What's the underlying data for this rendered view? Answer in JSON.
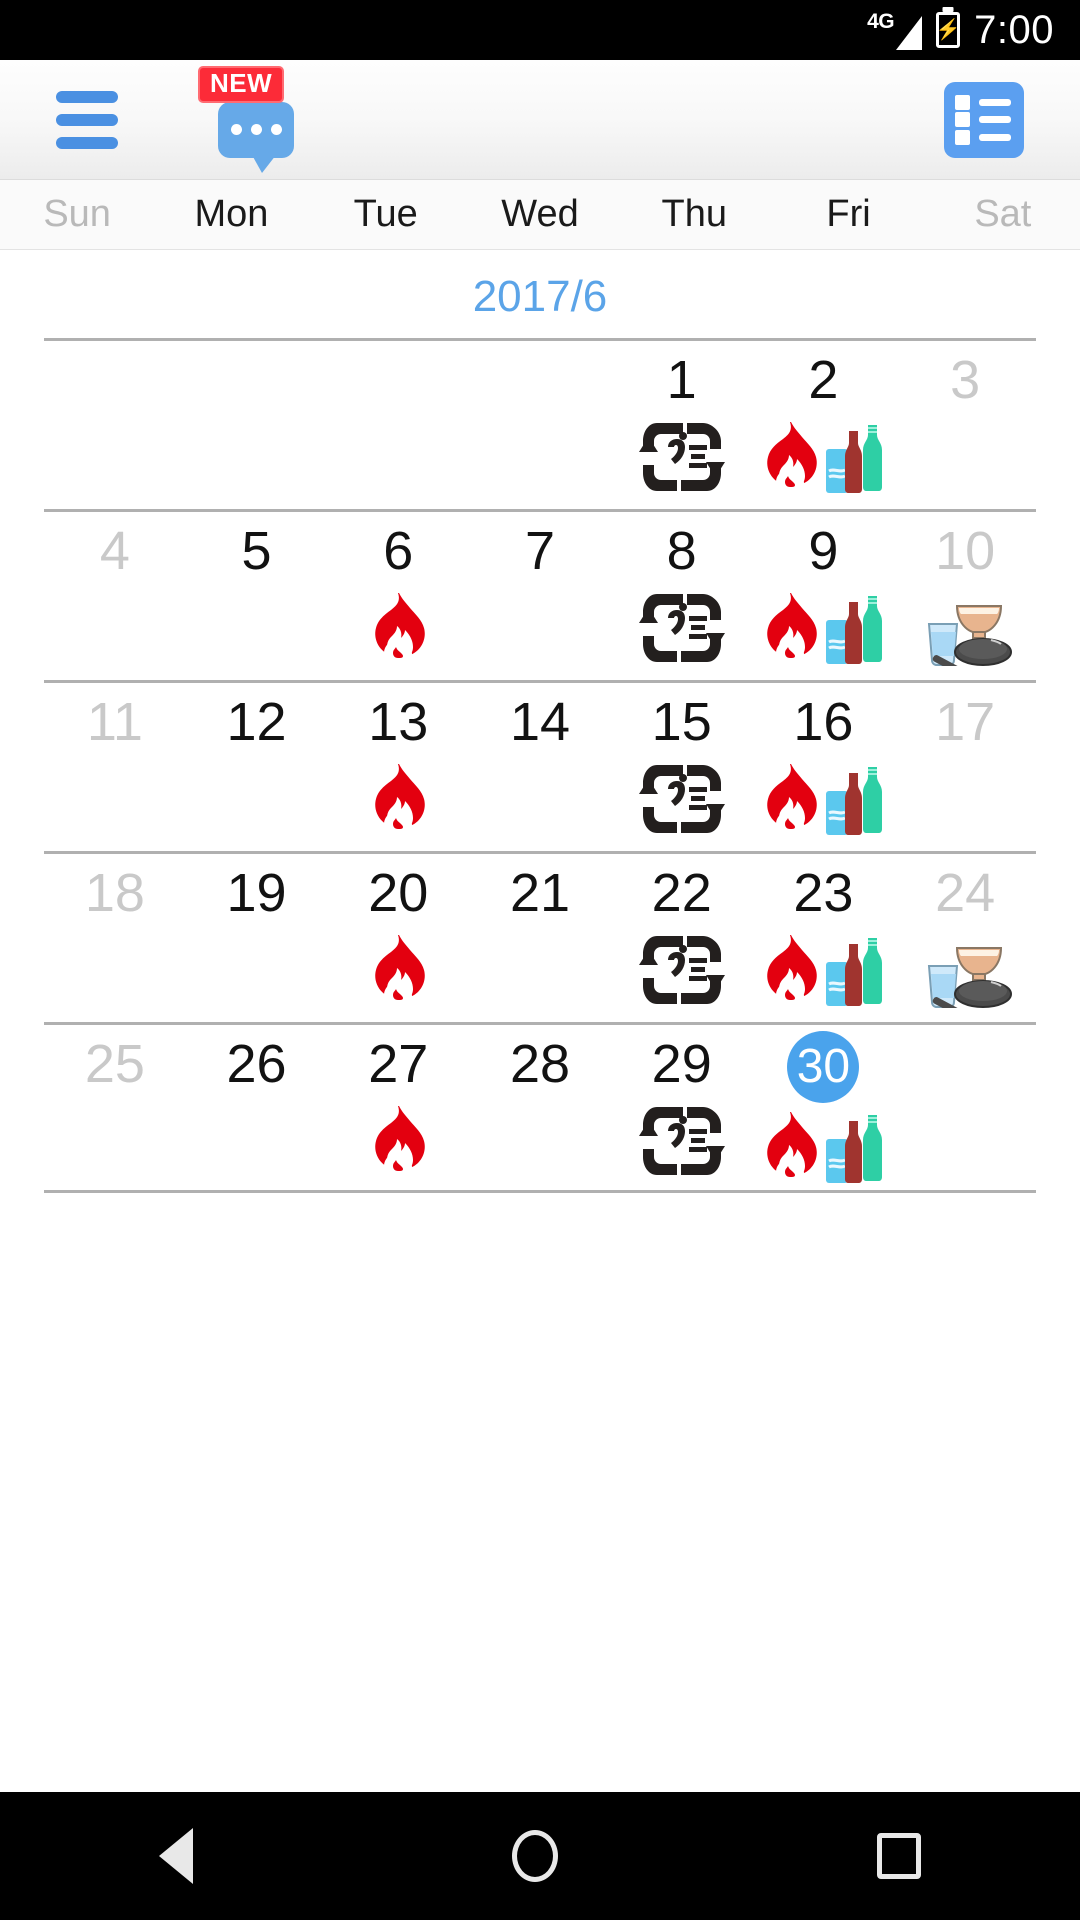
{
  "status_bar": {
    "network": "4G",
    "battery_icon": "battery-charging-icon",
    "time": "7:00"
  },
  "toolbar": {
    "menu_icon": "hamburger-menu-icon",
    "chat_icon": "chat-bubble-icon",
    "new_badge": "NEW",
    "list_icon": "agenda-list-icon"
  },
  "weekdays": [
    {
      "label": "Sun",
      "weekend": true
    },
    {
      "label": "Mon",
      "weekend": false
    },
    {
      "label": "Tue",
      "weekend": false
    },
    {
      "label": "Wed",
      "weekend": false
    },
    {
      "label": "Thu",
      "weekend": false
    },
    {
      "label": "Fri",
      "weekend": false
    },
    {
      "label": "Sat",
      "weekend": true
    }
  ],
  "month_title": "2017/6",
  "nav": {
    "prev_month_icon": "chevron-left-icon",
    "prev_month_label": "‹",
    "next_month_icon": "chevron-right-icon",
    "next_month_label": "›"
  },
  "colors": {
    "accent_blue": "#4a9de8",
    "today_blue": "#4aa3ec",
    "flame_red": "#e3000f",
    "badge_red": "#fc2b38",
    "weekend_gray": "#c9c9c9",
    "plastic_dark": "#231f1e"
  },
  "legend": {
    "flame": "burnable-garbage-icon",
    "plastic": "plastic-recycle-icon",
    "bottles": "bottles-and-cans-icon",
    "nonburnable": "non-burnable-garbage-icon"
  },
  "weeks": [
    [
      {
        "day": "",
        "weekend": true,
        "today": false,
        "icons": []
      },
      {
        "day": "",
        "weekend": false,
        "today": false,
        "icons": []
      },
      {
        "day": "",
        "weekend": false,
        "today": false,
        "icons": []
      },
      {
        "day": "",
        "weekend": false,
        "today": false,
        "icons": []
      },
      {
        "day": "1",
        "weekend": false,
        "today": false,
        "icons": [
          "plastic"
        ]
      },
      {
        "day": "2",
        "weekend": false,
        "today": false,
        "icons": [
          "flame",
          "bottles"
        ]
      },
      {
        "day": "3",
        "weekend": true,
        "today": false,
        "icons": []
      }
    ],
    [
      {
        "day": "4",
        "weekend": true,
        "today": false,
        "icons": []
      },
      {
        "day": "5",
        "weekend": false,
        "today": false,
        "icons": []
      },
      {
        "day": "6",
        "weekend": false,
        "today": false,
        "icons": [
          "flame"
        ]
      },
      {
        "day": "7",
        "weekend": false,
        "today": false,
        "icons": []
      },
      {
        "day": "8",
        "weekend": false,
        "today": false,
        "icons": [
          "plastic"
        ]
      },
      {
        "day": "9",
        "weekend": false,
        "today": false,
        "icons": [
          "flame",
          "bottles"
        ]
      },
      {
        "day": "10",
        "weekend": true,
        "today": false,
        "icons": [
          "nonburnable"
        ]
      }
    ],
    [
      {
        "day": "11",
        "weekend": true,
        "today": false,
        "icons": []
      },
      {
        "day": "12",
        "weekend": false,
        "today": false,
        "icons": []
      },
      {
        "day": "13",
        "weekend": false,
        "today": false,
        "icons": [
          "flame"
        ]
      },
      {
        "day": "14",
        "weekend": false,
        "today": false,
        "icons": []
      },
      {
        "day": "15",
        "weekend": false,
        "today": false,
        "icons": [
          "plastic"
        ]
      },
      {
        "day": "16",
        "weekend": false,
        "today": false,
        "icons": [
          "flame",
          "bottles"
        ]
      },
      {
        "day": "17",
        "weekend": true,
        "today": false,
        "icons": []
      }
    ],
    [
      {
        "day": "18",
        "weekend": true,
        "today": false,
        "icons": []
      },
      {
        "day": "19",
        "weekend": false,
        "today": false,
        "icons": []
      },
      {
        "day": "20",
        "weekend": false,
        "today": false,
        "icons": [
          "flame"
        ]
      },
      {
        "day": "21",
        "weekend": false,
        "today": false,
        "icons": []
      },
      {
        "day": "22",
        "weekend": false,
        "today": false,
        "icons": [
          "plastic"
        ]
      },
      {
        "day": "23",
        "weekend": false,
        "today": false,
        "icons": [
          "flame",
          "bottles"
        ]
      },
      {
        "day": "24",
        "weekend": true,
        "today": false,
        "icons": [
          "nonburnable"
        ]
      }
    ],
    [
      {
        "day": "25",
        "weekend": true,
        "today": false,
        "icons": []
      },
      {
        "day": "26",
        "weekend": false,
        "today": false,
        "icons": []
      },
      {
        "day": "27",
        "weekend": false,
        "today": false,
        "icons": [
          "flame"
        ]
      },
      {
        "day": "28",
        "weekend": false,
        "today": false,
        "icons": []
      },
      {
        "day": "29",
        "weekend": false,
        "today": false,
        "icons": [
          "plastic"
        ]
      },
      {
        "day": "30",
        "weekend": false,
        "today": true,
        "icons": [
          "flame",
          "bottles"
        ]
      },
      {
        "day": "",
        "weekend": true,
        "today": false,
        "icons": []
      }
    ]
  ],
  "bottom_nav": {
    "back": "back-triangle-icon",
    "home": "home-circle-icon",
    "recents": "recents-square-icon"
  }
}
